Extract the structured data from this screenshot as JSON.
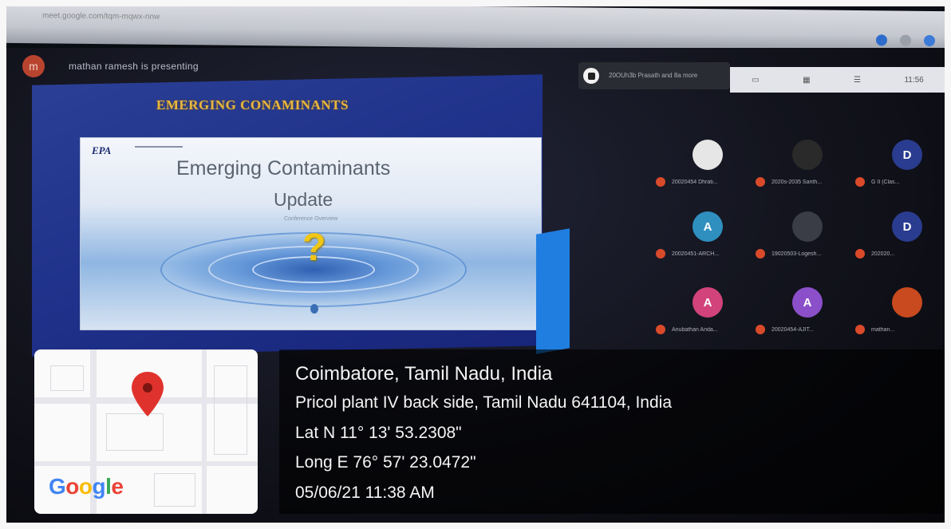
{
  "browser": {
    "url_text": "meet.google.com/tqm-mqwx-nnw"
  },
  "meeting": {
    "presenter_initial": "m",
    "presenter_text": "mathan ramesh is presenting",
    "top_chip_text": "20OUh3b Prasath and 8a more",
    "toolbar": {
      "time": "11:56"
    }
  },
  "slide": {
    "heading": "EMERGING CONAMINANTS",
    "logo": "EPA",
    "title_line1": "Emerging Contaminants",
    "title_line2": "Update",
    "subtitle": "Conference Overview",
    "question_mark": "?"
  },
  "participants": [
    {
      "initial": "",
      "name": "20020454 Dhrati...",
      "color": "#e6e6e6"
    },
    {
      "initial": "",
      "name": "2020s-2035 Santh...",
      "color": "#2a2a2a"
    },
    {
      "initial": "D",
      "name": "G II (Clas...",
      "color": "#2a3c8f"
    },
    {
      "initial": "A",
      "name": "20020451-ARCH...",
      "color": "#2f8fbf"
    },
    {
      "initial": "",
      "name": "19020503-Logesh...",
      "color": "#3b3d46"
    },
    {
      "initial": "D",
      "name": "202020...",
      "color": "#2a3c8f"
    },
    {
      "initial": "A",
      "name": "Anubathan Anda...",
      "color": "#d1437a"
    },
    {
      "initial": "A",
      "name": "20020454-AJIT...",
      "color": "#8b4fc9"
    },
    {
      "initial": "",
      "name": "mathan...",
      "color": "#c94a1e"
    }
  ],
  "map": {
    "logo": "Google",
    "logo_colors": [
      "#4285f4",
      "#ea4335",
      "#fbbc05",
      "#4285f4",
      "#34a853",
      "#ea4335"
    ],
    "pin_color": "#e0322c"
  },
  "location": {
    "city": "Coimbatore, Tamil Nadu, India",
    "address": "Pricol plant IV back side, Tamil Nadu 641104, India",
    "lat": "Lat N 11° 13' 53.2308\"",
    "long": "Long E 76° 57' 23.0472\"",
    "datetime": "05/06/21 11:38 AM"
  }
}
